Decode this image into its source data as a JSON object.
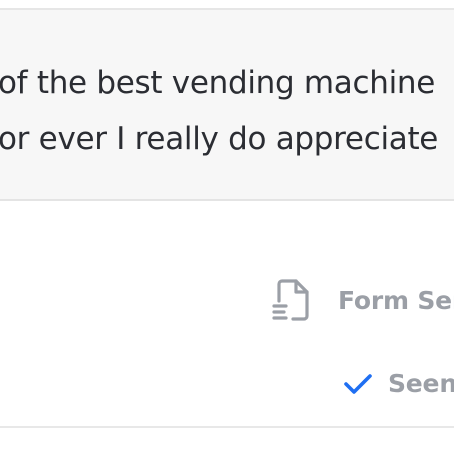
{
  "message": {
    "line_1": "of the best vending machine",
    "line_2": "or ever I really do appreciate"
  },
  "meta": {
    "source_icon": "form-document-icon",
    "source_label": "Form Ser",
    "status_icon": "checkmark-icon",
    "status_label": "Seen"
  },
  "colors": {
    "bubble_background": "#f7f7f7",
    "message_text": "#2b2d33",
    "meta_text": "#9b9fa6",
    "check_blue": "#1f6ff2"
  }
}
